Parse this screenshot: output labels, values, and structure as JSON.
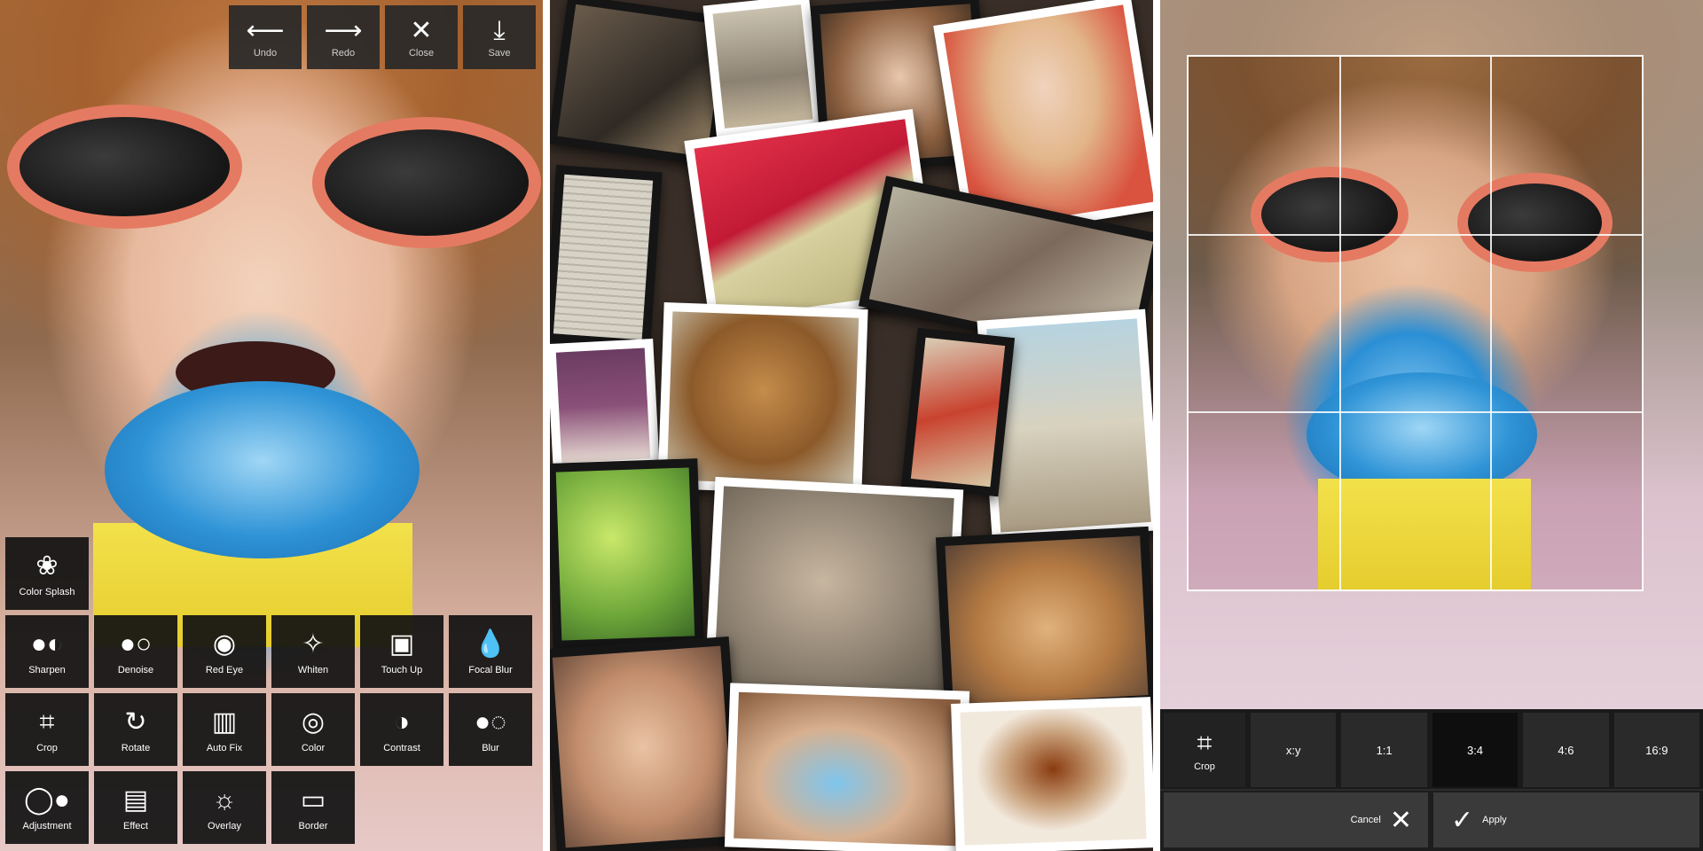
{
  "editor": {
    "toolbar": [
      {
        "label": "Undo",
        "icon": "arrow-left-icon",
        "glyph": "⟵"
      },
      {
        "label": "Redo",
        "icon": "arrow-right-icon",
        "glyph": "⟶"
      },
      {
        "label": "Close",
        "icon": "close-icon",
        "glyph": "✕"
      },
      {
        "label": "Save",
        "icon": "download-icon",
        "glyph": "⤓"
      }
    ],
    "color_splash": {
      "label": "Color Splash",
      "icon": "flower-icon",
      "glyph": "❀"
    },
    "tools": [
      {
        "label": "Sharpen",
        "icon": "sharpen-icon",
        "glyph": "●◐"
      },
      {
        "label": "Denoise",
        "icon": "denoise-icon",
        "glyph": "●○"
      },
      {
        "label": "Red Eye",
        "icon": "eye-icon",
        "glyph": "◉"
      },
      {
        "label": "Whiten",
        "icon": "sparkle-icon",
        "glyph": "✧"
      },
      {
        "label": "Touch Up",
        "icon": "touch-up-icon",
        "glyph": "▣"
      },
      {
        "label": "Focal Blur",
        "icon": "drops-icon",
        "glyph": "💧"
      },
      {
        "label": "Crop",
        "icon": "crop-icon",
        "glyph": "⌗"
      },
      {
        "label": "Rotate",
        "icon": "rotate-icon",
        "glyph": "↻"
      },
      {
        "label": "Auto Fix",
        "icon": "histogram-icon",
        "glyph": "▥"
      },
      {
        "label": "Color",
        "icon": "color-icon",
        "glyph": "◎"
      },
      {
        "label": "Contrast",
        "icon": "contrast-icon",
        "glyph": "◑"
      },
      {
        "label": "Blur",
        "icon": "blur-icon",
        "glyph": "●◌"
      },
      {
        "label": "Adjustment",
        "icon": "adjustment-icon",
        "glyph": "◯●"
      },
      {
        "label": "Effect",
        "icon": "film-icon",
        "glyph": "▤"
      },
      {
        "label": "Overlay",
        "icon": "bulb-icon",
        "glyph": "☼"
      },
      {
        "label": "Border",
        "icon": "border-icon",
        "glyph": "▭"
      }
    ]
  },
  "crop": {
    "ratios": [
      {
        "label": "x:y"
      },
      {
        "label": "1:1"
      },
      {
        "label": "3:4",
        "active": true
      },
      {
        "label": "4:6"
      },
      {
        "label": "16:9"
      }
    ],
    "crop_tool": {
      "label": "Crop",
      "icon": "crop-icon",
      "glyph": "⌗"
    },
    "cancel": {
      "label": "Cancel",
      "icon": "close-icon",
      "glyph": "✕"
    },
    "apply": {
      "label": "Apply",
      "icon": "check-icon",
      "glyph": "✓"
    }
  }
}
